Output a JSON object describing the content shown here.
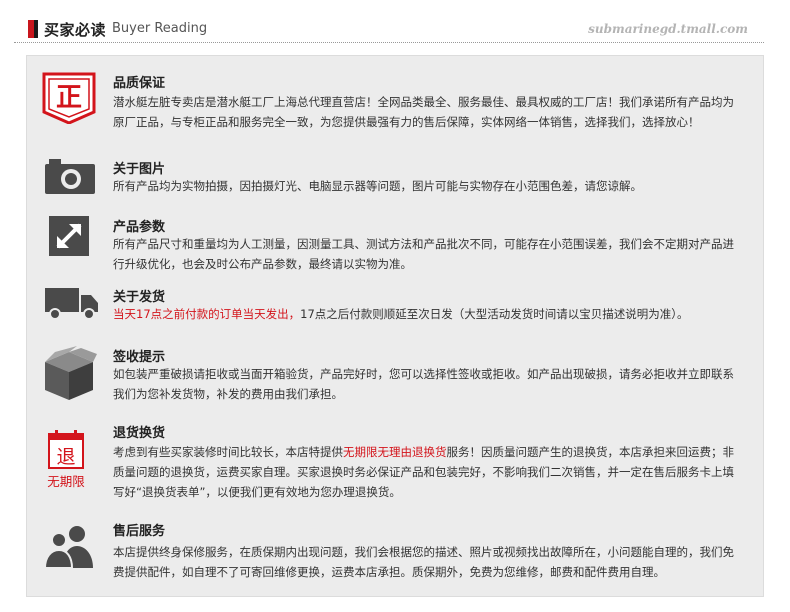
{
  "header": {
    "title_cn": "买家必读",
    "title_en": "Buyer Reading",
    "store_url": "submarinegd.tmall.com"
  },
  "sections": [
    {
      "icon": "zheng-seal-icon",
      "icon_text": "正",
      "title": "品质保证",
      "text": "潜水艇左脏专卖店是潜水艇工厂上海总代理直营店！全网品类最全、服务最佳、最具权威的工厂店！我们承诺所有产品均为原厂正品，与专柜正品和服务完全一致，为您提供最强有力的售后保障，实体网络一体销售，选择我们，选择放心！"
    },
    {
      "icon": "camera-icon",
      "title": "关于图片",
      "text": "所有产品均为实物拍摄，因拍摄灯光、电脑显示器等问题，图片可能与实物存在小范围色差，请您谅解。"
    },
    {
      "icon": "resize-arrow-icon",
      "title": "产品参数",
      "text": "所有产品尺寸和重量均为人工测量，因测量工具、测试方法和产品批次不同，可能存在小范围误差，我们会不定期对产品进行升级优化，也会及时公布产品参数，最终请以实物为准。"
    },
    {
      "icon": "truck-icon",
      "title": "关于发货",
      "text_highlight": "当天17点之前付款的订单当天发出，",
      "text": "17点之后付款则顺延至次日发（大型活动发货时间请以宝贝描述说明为准）。"
    },
    {
      "icon": "package-box-icon",
      "title": "签收提示",
      "text": "如包装严重破损请拒收或当面开箱验货，产品完好时，您可以选择性签收或拒收。如产品出现破损，请务必拒收并立即联系我们为您补发货物，补发的费用由我们承担。"
    },
    {
      "icon": "return-calendar-icon",
      "icon_text": "退",
      "icon_caption": "无期限",
      "title": "退货换货",
      "text_before": "考虑到有些买家装修时间比较长，本店特提供",
      "text_highlight": "无期限无理由退换货",
      "text_after": "服务！因质量问题产生的退换货，本店承担来回运费；非质量问题的退换货，运费买家自理。买家退换时务必保证产品和包装完好，不影响我们二次销售，并一定在售后服务卡上填写好“退换货表单”，以便我们更有效地为您办理退换货。"
    },
    {
      "icon": "people-icon",
      "title": "售后服务",
      "text": "本店提供终身保修服务，在质保期内出现问题，我们会根据您的描述、照片或视频找出故障所在，小问题能自理的，我们免费提供配件，如自理不了可寄回维修更换，运费本店承担。质保期外，免费为您维修，邮费和配件费用自理。"
    }
  ],
  "colors": {
    "accent_red": "#d3141b",
    "icon_gray": "#4a4a4a",
    "panel_bg": "#ececec"
  }
}
